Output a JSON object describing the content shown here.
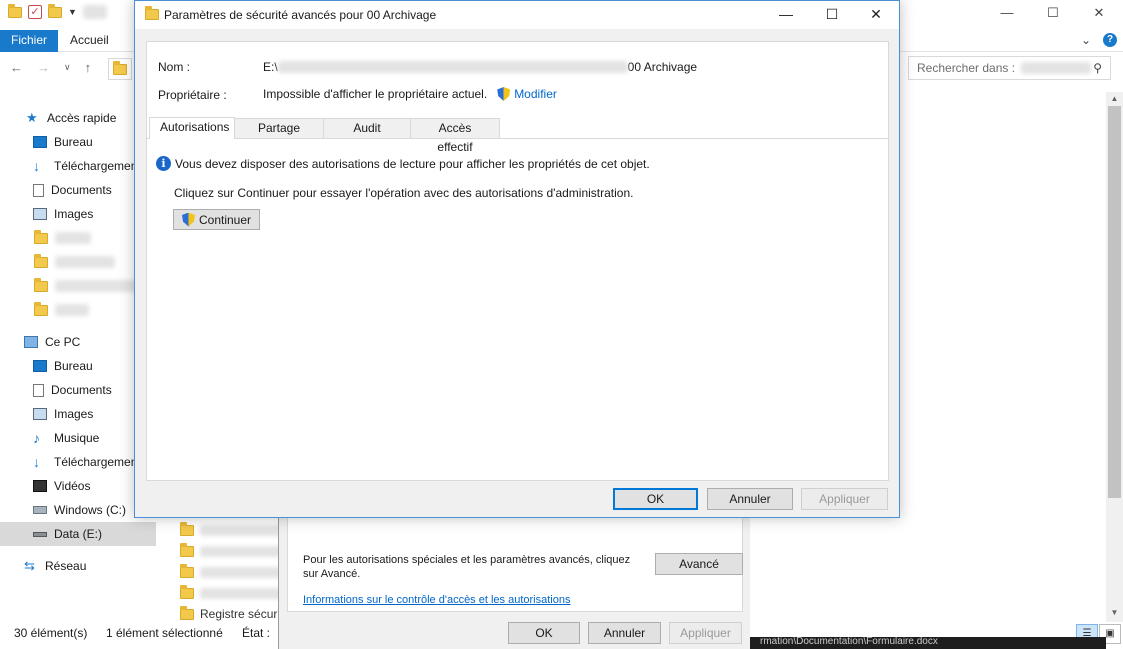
{
  "explorer": {
    "ribbon": {
      "file_tab": "Fichier",
      "home_tab": "Accueil"
    },
    "search_placeholder": "Rechercher dans :",
    "sidebar": [
      {
        "label": "Accès rapide",
        "icon": "star-icon"
      },
      {
        "label": "Bureau",
        "icon": "desktop-icon"
      },
      {
        "label": "Téléchargemen",
        "icon": "download-icon"
      },
      {
        "label": "Documents",
        "icon": "documents-icon"
      },
      {
        "label": "Images",
        "icon": "images-icon"
      },
      {
        "label": "Ce PC",
        "icon": "pc-icon"
      },
      {
        "label": "Bureau",
        "icon": "desktop-icon"
      },
      {
        "label": "Documents",
        "icon": "documents-icon"
      },
      {
        "label": "Images",
        "icon": "images-icon"
      },
      {
        "label": "Musique",
        "icon": "music-icon"
      },
      {
        "label": "Téléchargemen",
        "icon": "download-icon"
      },
      {
        "label": "Vidéos",
        "icon": "videos-icon"
      },
      {
        "label": "Windows (C:)",
        "icon": "drive-icon"
      },
      {
        "label": "Data (E:)",
        "icon": "drive-icon"
      },
      {
        "label": "Réseau",
        "icon": "network-icon"
      }
    ],
    "file_list_item": "Registre sécurit",
    "status": {
      "count": "30 élément(s)",
      "selected": "1 élément sélectionné",
      "state": "État :"
    },
    "dark_strip_text": "rmation\\Documentation\\Formulaire.docx"
  },
  "properties_dialog": {
    "advanced_text": "Pour les autorisations spéciales et les paramètres avancés, cliquez sur Avancé.",
    "advanced_button": "Avancé",
    "info_link": "Informations sur le contrôle d'accès et les autorisations",
    "ok": "OK",
    "cancel": "Annuler",
    "apply": "Appliquer"
  },
  "dialog": {
    "title": "Paramètres de sécurité avancés pour 00 Archivage",
    "name_label": "Nom :",
    "name_prefix": "E:\\",
    "name_suffix": "00 Archivage",
    "owner_label": "Propriétaire :",
    "owner_value": "Impossible d'afficher le propriétaire actuel.",
    "owner_link": "Modifier",
    "tabs": [
      "Autorisations",
      "Partage",
      "Audit",
      "Accès effectif"
    ],
    "active_tab": 0,
    "info_message": "Vous devez disposer des autorisations de lecture pour afficher les propriétés de cet objet.",
    "continue_message": "Cliquez sur Continuer pour essayer l'opération avec des autorisations d'administration.",
    "continue_button": "Continuer",
    "ok": "OK",
    "cancel": "Annuler",
    "apply": "Appliquer"
  },
  "colors": {
    "accent": "#1979ca",
    "link": "#0066cc",
    "dialog_border": "#4a90d9"
  }
}
